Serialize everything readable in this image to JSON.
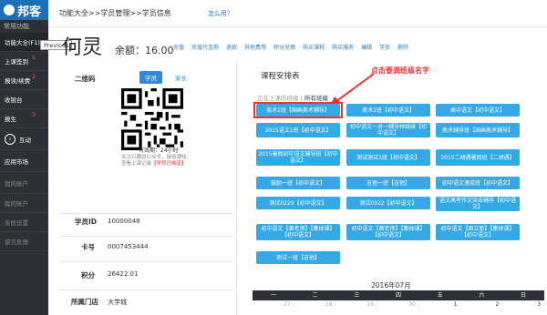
{
  "brand": "邦客",
  "sidebar": {
    "header": "常用功能",
    "items": [
      {
        "label": "功能大全(F1)"
      },
      {
        "label": "上课签到",
        "badge": "1"
      },
      {
        "label": "报读/续费",
        "badge": "2"
      },
      {
        "label": "收银台"
      },
      {
        "label": "报生",
        "badge": "3"
      },
      {
        "label": "互动"
      },
      {
        "label": "应用市场"
      },
      {
        "label": "我的账户"
      },
      {
        "label": "我的账户"
      },
      {
        "label": "系统设置"
      },
      {
        "label": "留言反馈"
      }
    ],
    "tooltip": "Previous"
  },
  "breadcrumb": "功能大全>>学员管理>>学员信息",
  "help": "怎么用？",
  "student": {
    "name": "何灵",
    "balance": "余额：16.00"
  },
  "actions": [
    "充值",
    "充值代金券",
    "退款",
    "其他费用",
    "积分兑换",
    "购买课程",
    "购买服务",
    "编辑",
    "学员",
    "删除"
  ],
  "left": {
    "qr_label": "二维码",
    "tabs": [
      "学员",
      "家长"
    ],
    "valid": "有效期：24小时",
    "hint": "关注兴趣班公众号，接收通知、查看上课记录",
    "hint_red": "【学员已绑定】",
    "fields": [
      {
        "label": "学员ID",
        "value": "10000048"
      },
      {
        "label": "卡号",
        "value": "0007453444"
      },
      {
        "label": "积分",
        "value": "26422.01"
      },
      {
        "label": "所属门店",
        "value": "大学城"
      }
    ]
  },
  "schedule": {
    "title": "课程安排表",
    "annotation": "点击要调班级名字",
    "filter_a": "正在上课的班级",
    "filter_b": "所有班级",
    "classes": [
      "美术2班【国画美术辅导】",
      "美术2班【初中语文】",
      "高中语文【初中语文】",
      "2015语文1班【初中语文】",
      "初中语文一对一辅导林妹妹【初中语文】",
      "美术辅导班【国画美术辅导】",
      "2015暑假初中语文辅导班【初中语文】",
      "测试测试1班【初中语文】",
      "2015二胡遇暑假班【二胡遇】",
      "鼓励一班【初中语文】",
      "吉他一班【吉他】",
      "初中语文速成班【初中语文】",
      "测试0229【初中语文】",
      "测试0322【初中语文】",
      "语文高考作文突击辅导【初中语文】",
      "初中语文【黄老师】【集体课】【初中语文】",
      "初中语文【黄老师】【集体课】【初中语文】",
      "初中语文【周立新】【集体课】【初中语文】",
      "测试一班【吉他】"
    ],
    "month": "2016年07月",
    "weekdays": [
      "一",
      "二",
      "三",
      "四",
      "五",
      "六",
      "日"
    ],
    "first_row": [
      "27",
      "28",
      "29",
      "30",
      "1",
      "2",
      "3"
    ]
  }
}
